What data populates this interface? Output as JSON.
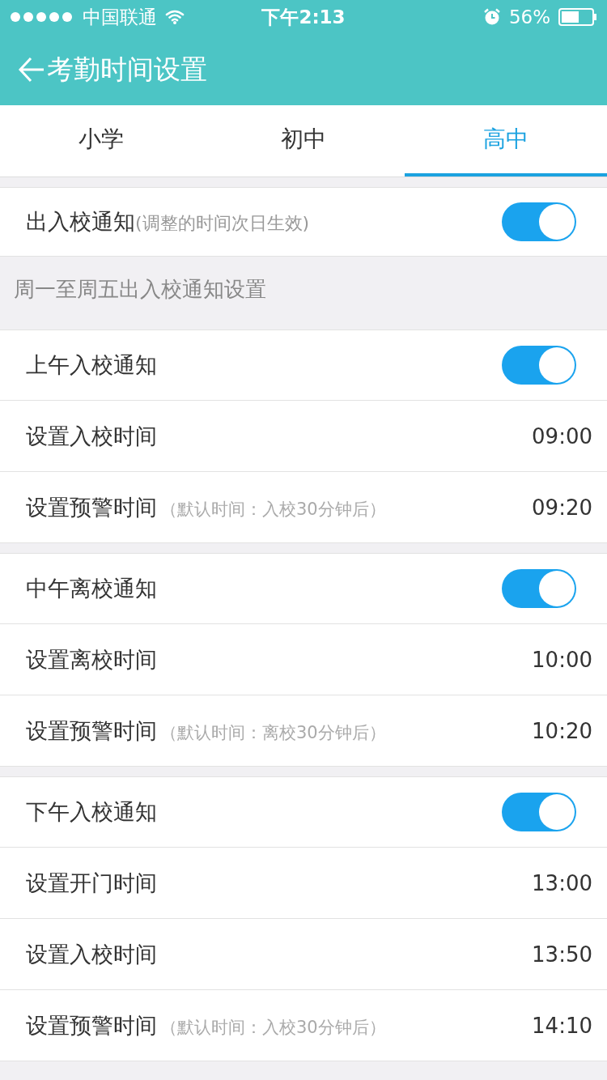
{
  "status_bar": {
    "carrier": "中国联通",
    "time": "下午2:13",
    "battery": "56%"
  },
  "nav": {
    "title": "考勤时间设置"
  },
  "tabs": [
    {
      "label": "小学",
      "selected": false
    },
    {
      "label": "初中",
      "selected": false
    },
    {
      "label": "高中",
      "selected": true
    }
  ],
  "master": {
    "label": "出入校通知",
    "hint": "(调整的时间次日生效)",
    "on": true
  },
  "section_title": "周一至周五出入校通知设置",
  "groups": [
    {
      "rows": [
        {
          "kind": "toggle",
          "label": "上午入校通知",
          "on": true
        },
        {
          "kind": "time",
          "label": "设置入校时间",
          "value": "09:00"
        },
        {
          "kind": "time",
          "label": "设置预警时间",
          "hint": "（默认时间：入校30分钟后）",
          "value": "09:20"
        }
      ]
    },
    {
      "rows": [
        {
          "kind": "toggle",
          "label": "中午离校通知",
          "on": true
        },
        {
          "kind": "time",
          "label": "设置离校时间",
          "value": "10:00"
        },
        {
          "kind": "time",
          "label": "设置预警时间",
          "hint": "（默认时间：离校30分钟后）",
          "value": "10:20"
        }
      ]
    },
    {
      "rows": [
        {
          "kind": "toggle",
          "label": "下午入校通知",
          "on": true
        },
        {
          "kind": "time",
          "label": "设置开门时间",
          "value": "13:00"
        },
        {
          "kind": "time",
          "label": "设置入校时间",
          "value": "13:50"
        },
        {
          "kind": "time",
          "label": "设置预警时间",
          "hint": "（默认时间：入校30分钟后）",
          "value": "14:10"
        }
      ]
    }
  ]
}
